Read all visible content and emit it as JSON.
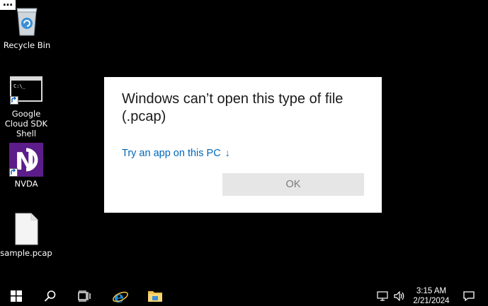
{
  "desktop": {
    "icons": [
      {
        "label": "Recycle Bin"
      },
      {
        "label": "Google Cloud SDK Shell"
      },
      {
        "label": "NVDA"
      },
      {
        "label": "sample.pcap"
      }
    ]
  },
  "dialog": {
    "title": "Windows can’t open this type of file (.pcap)",
    "link_label": "Try an app on this PC",
    "link_arrow": "↓",
    "ok_label": "OK"
  },
  "taskbar": {
    "time": "3:15 AM",
    "date": "2/21/2024",
    "icons": [
      "start-icon",
      "search-icon",
      "task-view-icon",
      "internet-explorer-icon",
      "file-explorer-icon",
      "network-icon",
      "volume-icon",
      "notification-icon"
    ]
  },
  "colors": {
    "accent_link": "#0067b8",
    "nvda_purple": "#5c1d8a",
    "ie_blue": "#1e8fd6",
    "folder_yellow": "#f2c14e"
  }
}
